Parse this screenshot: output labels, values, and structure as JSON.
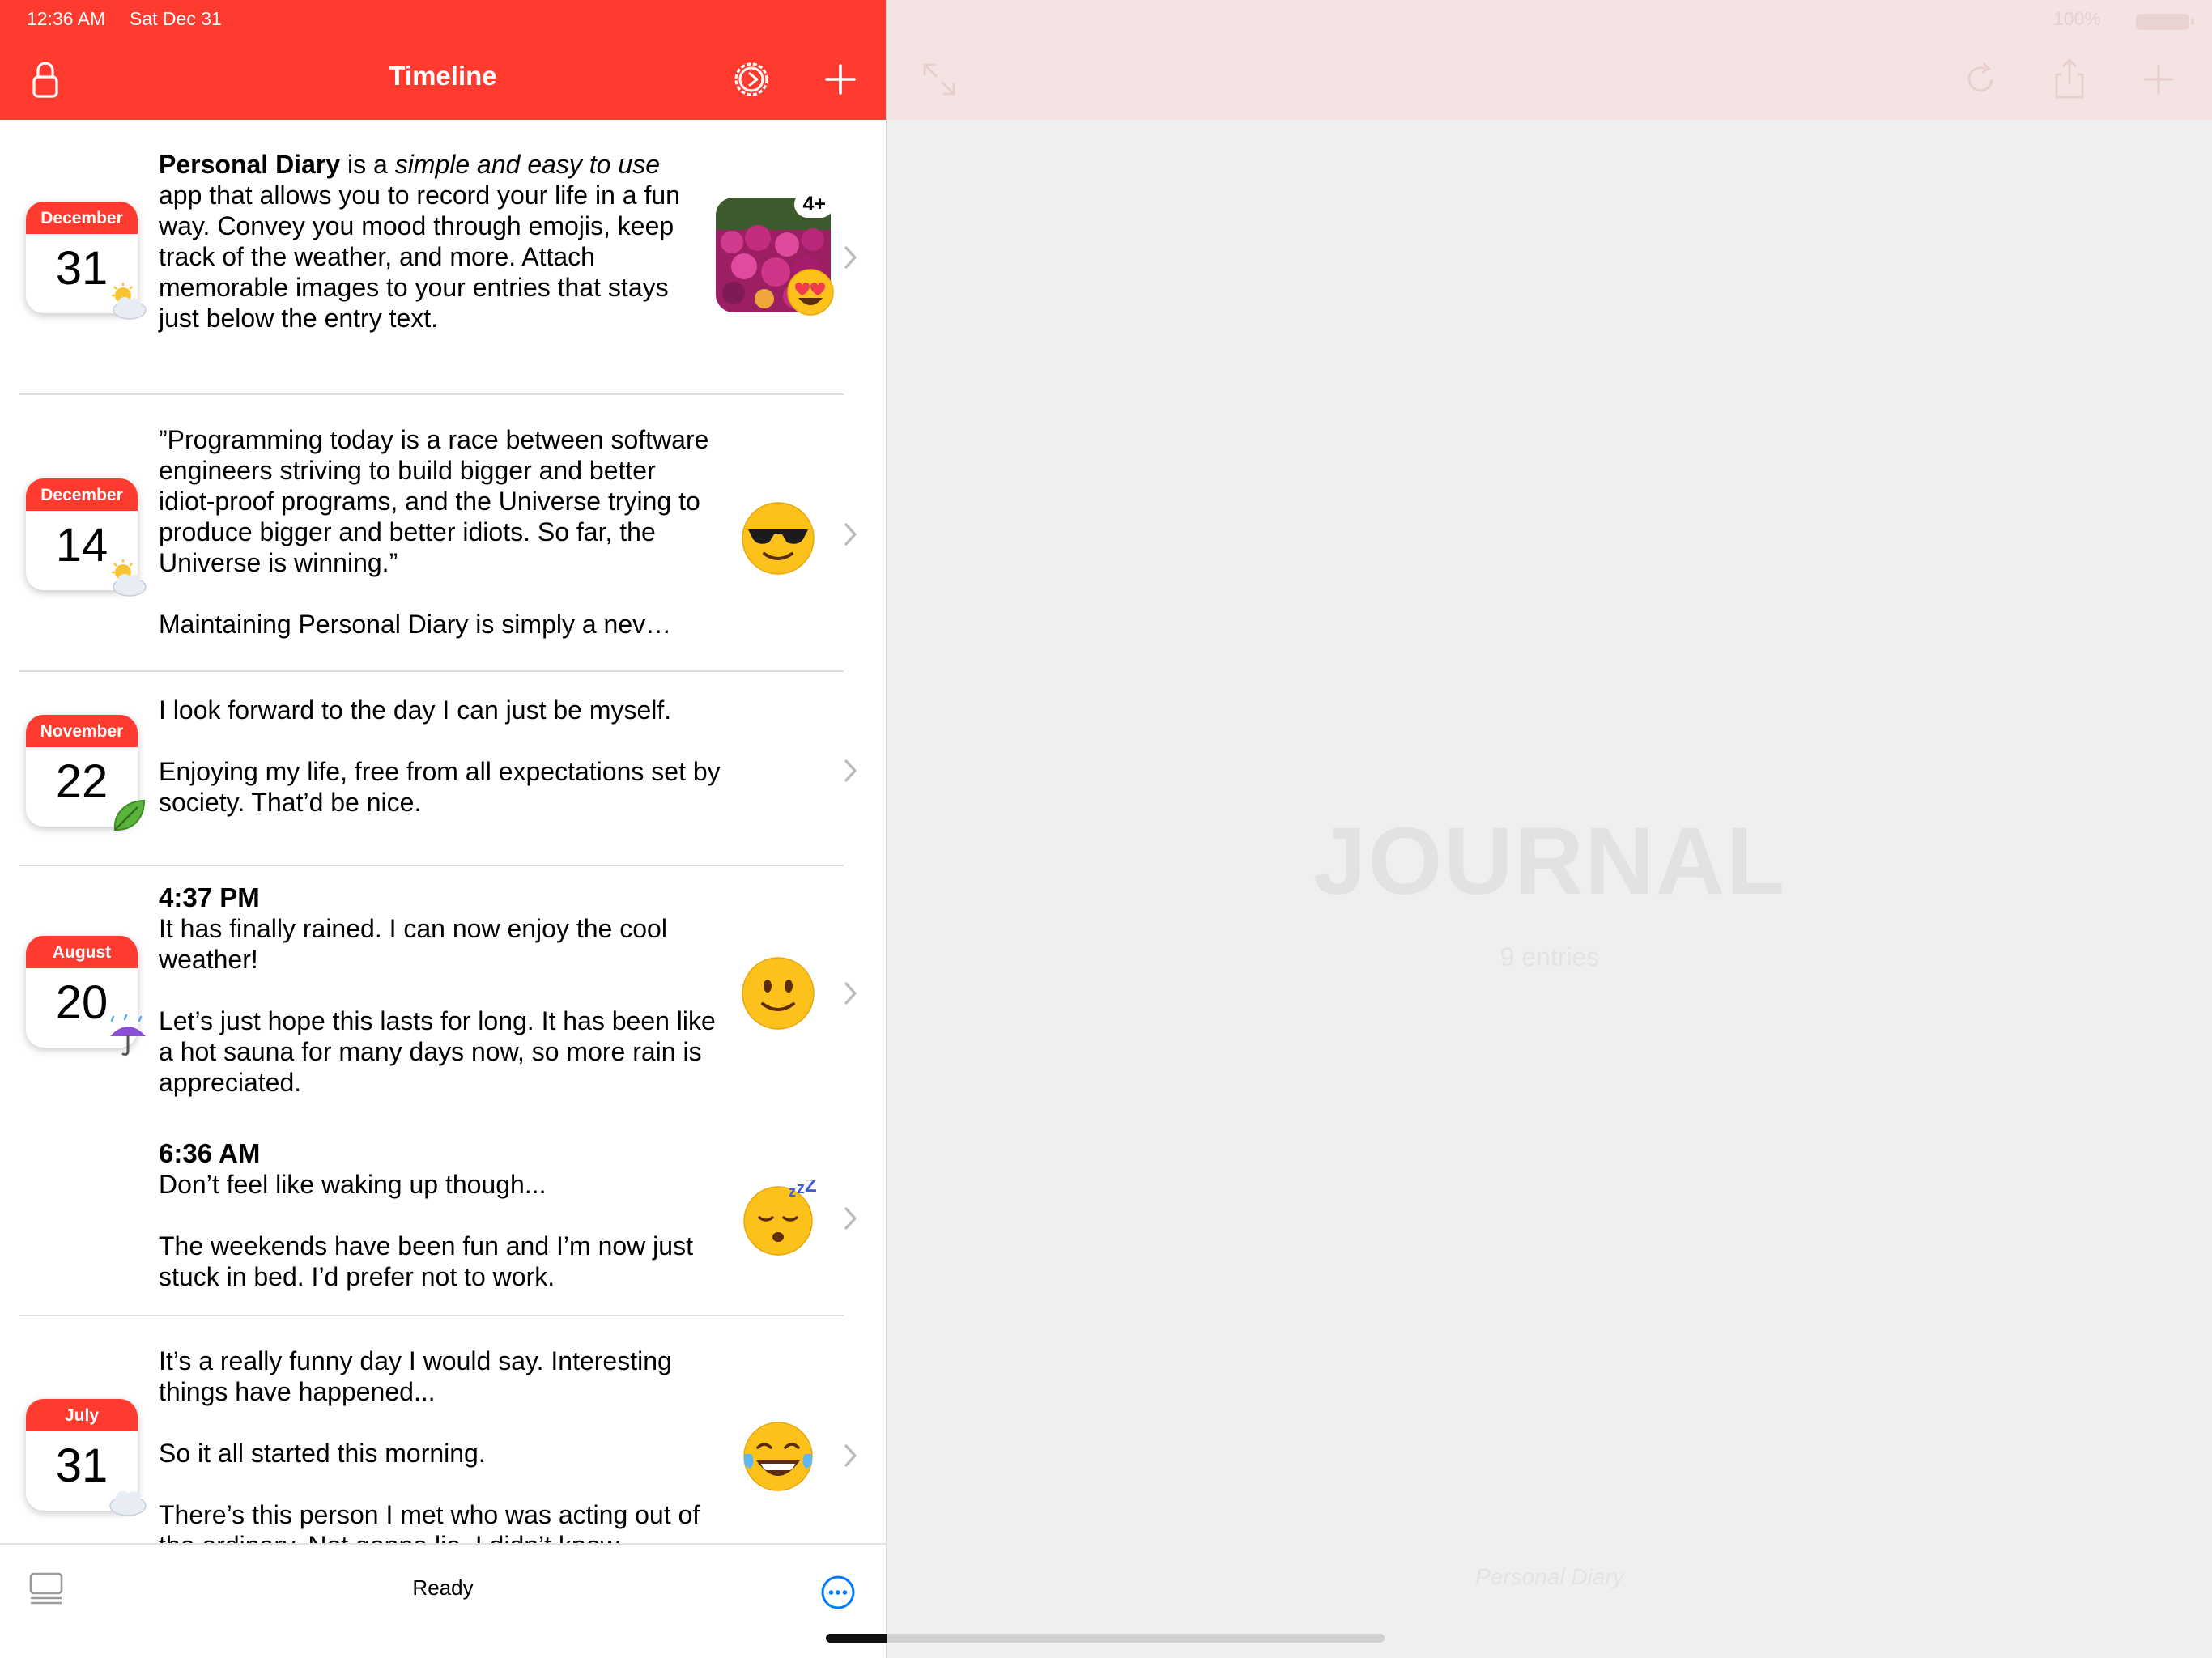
{
  "status_bar": {
    "time": "12:36 AM",
    "date": "Sat Dec 31",
    "battery": "100%"
  },
  "header": {
    "title": "Timeline"
  },
  "entries": [
    {
      "month": "December",
      "day": "31",
      "weather": "sun-behind-cloud-icon",
      "text": {
        "bold": "Personal Diary",
        "part1": " is a ",
        "italic": "simple and easy to use",
        "part2": " app that allows you to record your life in a fun way. Convey you mood through emojis, keep track of the weather, and more. Attach memorable images to your entries that stays just below the entry text."
      },
      "image_badge": "4+",
      "mood": "heart-eyes-emoji"
    },
    {
      "month": "December",
      "day": "14",
      "weather": "sun-behind-cloud-icon",
      "paragraphs": [
        "”Programming today is a race between software engineers striving to build bigger and better idiot-proof programs, and the Universe trying to produce bigger and better idiots. So far, the Universe is winning.”",
        "Maintaining Personal Diary is simply a nev…"
      ],
      "mood": "sunglasses-emoji"
    },
    {
      "month": "November",
      "day": "22",
      "weather": "leaf-icon",
      "paragraphs": [
        "I look forward to the day I can just be myself.",
        "Enjoying my life, free from all expectations set by society. That’d be nice."
      ]
    },
    {
      "month": "August",
      "day": "20",
      "weather": "umbrella-rain-icon",
      "sub_entries": [
        {
          "time": "4:37 PM",
          "paragraphs": [
            "It has finally rained. I can now enjoy the cool weather!",
            "Let’s just hope this lasts for long. It has been like a hot sauna for many days now, so more rain is appreciated."
          ],
          "mood": "slight-smile-emoji"
        },
        {
          "time": "6:36 AM",
          "paragraphs": [
            "Don’t feel like waking up though...",
            "The weekends have been fun and I’m now just stuck in bed. I’d prefer not to work."
          ],
          "mood": "sleeping-emoji"
        }
      ]
    },
    {
      "month": "July",
      "day": "31",
      "weather": "cloud-icon",
      "paragraphs": [
        "It’s a really funny day I would say. Interesting things have happened...",
        "So it all started this morning.",
        "There’s this person I met who was acting out of the ordinary. Not gonna lie, I didn’t know"
      ],
      "mood": "tears-of-joy-emoji"
    }
  ],
  "footer": {
    "status": "Ready"
  },
  "detail": {
    "title": "JOURNAL",
    "count": "9 entries",
    "app_name": "Personal Diary"
  },
  "colors": {
    "accent": "#ff3b30",
    "link": "#007aff"
  }
}
